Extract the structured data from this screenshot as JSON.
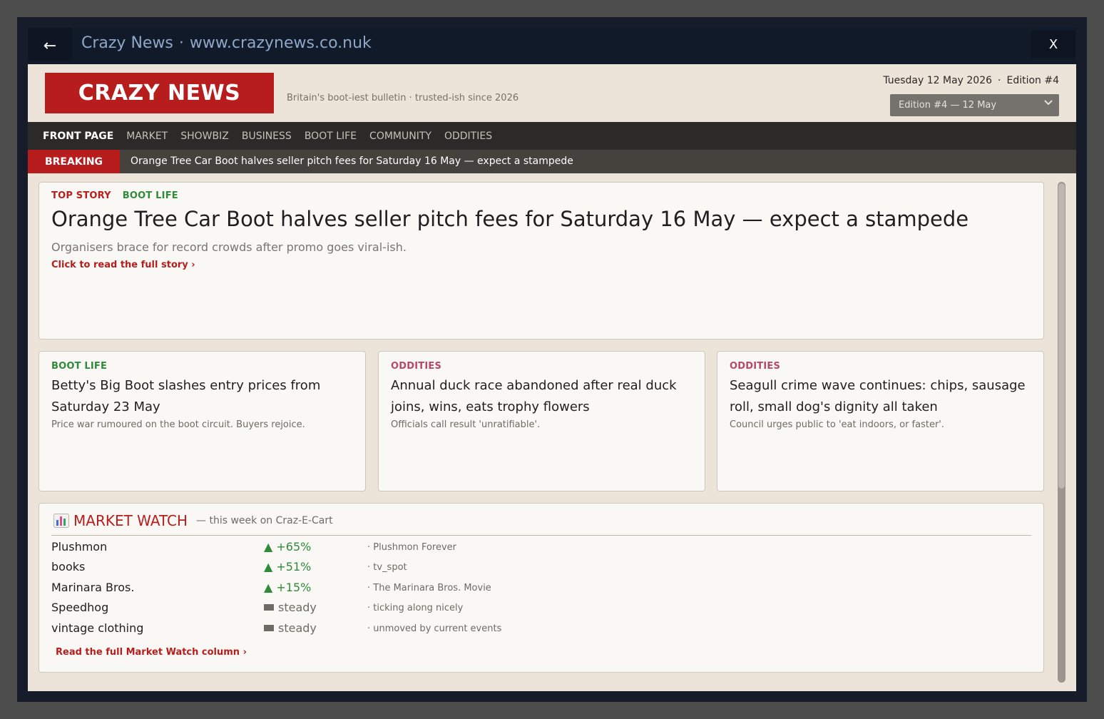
{
  "window": {
    "back_icon": "←",
    "site_name": "Crazy News",
    "separator": "·",
    "url": "www.crazynews.co.nuk",
    "close_label": "X"
  },
  "masthead": {
    "logo": "CRAZY NEWS",
    "tagline": "Britain's boot-iest bulletin · trusted-ish since 2026",
    "date": "Tuesday 12 May 2026",
    "separator": "·",
    "edition": "Edition #4",
    "edition_select": "Edition #4 — 12 May",
    "brand_color": "#b81d1d"
  },
  "nav": {
    "items": [
      "FRONT PAGE",
      "MARKET",
      "SHOWBIZ",
      "BUSINESS",
      "BOOT LIFE",
      "COMMUNITY",
      "ODDITIES"
    ],
    "active": "FRONT PAGE"
  },
  "breaking": {
    "label": "BREAKING",
    "text": "Orange Tree Car Boot halves seller pitch fees for Saturday 16 May — expect a stampede"
  },
  "top_story": {
    "kicker1": "TOP STORY",
    "kicker2": "BOOT LIFE",
    "headline": "Orange Tree Car Boot halves seller pitch fees for Saturday 16 May — expect a stampede",
    "sub": "Organisers brace for record crowds after promo goes viral-ish.",
    "read_more": "Click to read the full story ›"
  },
  "stories": [
    {
      "kicker": "BOOT LIFE",
      "headline": "Betty's Big Boot slashes entry prices from Saturday 23 May",
      "sub": "Price war rumoured on the boot circuit. Buyers rejoice."
    },
    {
      "kicker": "ODDITIES",
      "headline": "Annual duck race abandoned after real duck joins, wins, eats trophy flowers",
      "sub": "Officials call result 'unratifiable'."
    },
    {
      "kicker": "ODDITIES",
      "headline": "Seagull crime wave continues: chips, sausage roll, small dog's dignity all taken",
      "sub": "Council urges public to 'eat indoors, or faster'."
    }
  ],
  "market": {
    "icon": "bar-chart-icon",
    "title": "MARKET WATCH",
    "subtitle": "— this week on Craz-E-Cart",
    "rows": [
      {
        "name": "Plushmon",
        "change": "▲ +65%",
        "trend": "up",
        "note": "· Plushmon Forever"
      },
      {
        "name": "books",
        "change": "▲ +51%",
        "trend": "up",
        "note": "· tv_spot"
      },
      {
        "name": "Marinara Bros.",
        "change": "▲ +15%",
        "trend": "up",
        "note": "· The Marinara Bros. Movie"
      },
      {
        "name": "Speedhog",
        "change": "steady",
        "trend": "flat",
        "note": "· ticking along nicely"
      },
      {
        "name": "vintage clothing",
        "change": "steady",
        "trend": "flat",
        "note": "· unmoved by current events"
      }
    ],
    "read_more": "Read the full Market Watch column ›"
  }
}
